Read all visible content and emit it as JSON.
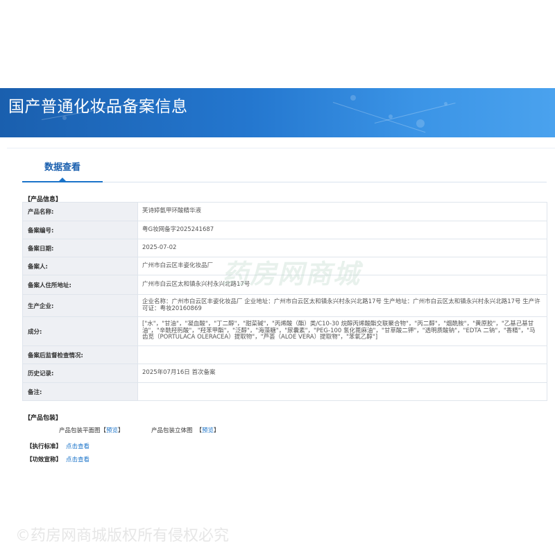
{
  "header": {
    "title": "国产普通化妆品备案信息"
  },
  "tabs": [
    {
      "label": "数据查看",
      "active": true
    }
  ],
  "product_info": {
    "section_title": "【产品信息】",
    "rows": [
      {
        "key": "产品名称:",
        "value": "芙诗婷氨甲环酸精华液"
      },
      {
        "key": "备案编号:",
        "value": "粤G妆网备字2025241687"
      },
      {
        "key": "备案日期:",
        "value": "2025-07-02"
      },
      {
        "key": "备案人:",
        "value": "广州市白云区丰姿化妆品厂"
      },
      {
        "key": "备案人住所地址:",
        "value": "广州市白云区太和镇永兴村永兴北路17号"
      },
      {
        "key": "生产企业:",
        "value": "企业名称：广州市白云区丰姿化妆品厂 企业地址：广州市白云区太和镇永兴村永兴北路17号 生产地址：广州市白云区太和镇永兴村永兴北路17号 生产许可证：粤妆20160869"
      },
      {
        "key": "成分:",
        "value": "[\"水\"，\"甘油\"，\"凝血酸\"，\"丁二醇\"，\"甜菜碱\"，\"丙烯酸（酯）类/C10-30 烷醇丙烯酸酯交联聚合物\"，\"丙二醇\"，\"烟酰胺\"，\"黄原胶\"，\"乙基己基甘油\"，\"辛酰羟肟酸\"，\"羟苯甲酯\"，\"泛醇\"，\"海藻糖\"，\"尿囊素\"，\"PEG-100 氢化蓖麻油\"，\"甘草酸二钾\"，\"透明质酸钠\"，\"EDTA 二钠\"，\"香精\"，\"马齿苋（PORTULACA OLERACEA）提取物\"，\"芦荟（ALOE VERA）提取物\"，\"苯氧乙醇\"]"
      },
      {
        "key": "备案后监督检查情况:",
        "value": ""
      },
      {
        "key": "历史记录:",
        "value": "2025年07月16日 首次备案"
      },
      {
        "key": "备注:",
        "value": ""
      }
    ]
  },
  "packaging": {
    "section_title": "【产品包装】",
    "flat_label": "产品包装平面图",
    "flat_link": "预览",
    "solid_label": "产品包装立体图",
    "solid_link": "预览",
    "bracket_open": "【",
    "bracket_close": "】"
  },
  "standards": {
    "label": "【执行标准】",
    "link": "点击查看"
  },
  "efficacy": {
    "label": "【功效宣称】",
    "link": "点击查看"
  },
  "watermarks": {
    "center": "药房网商城",
    "bottom": "©药房网商城版权所有侵权必究"
  }
}
